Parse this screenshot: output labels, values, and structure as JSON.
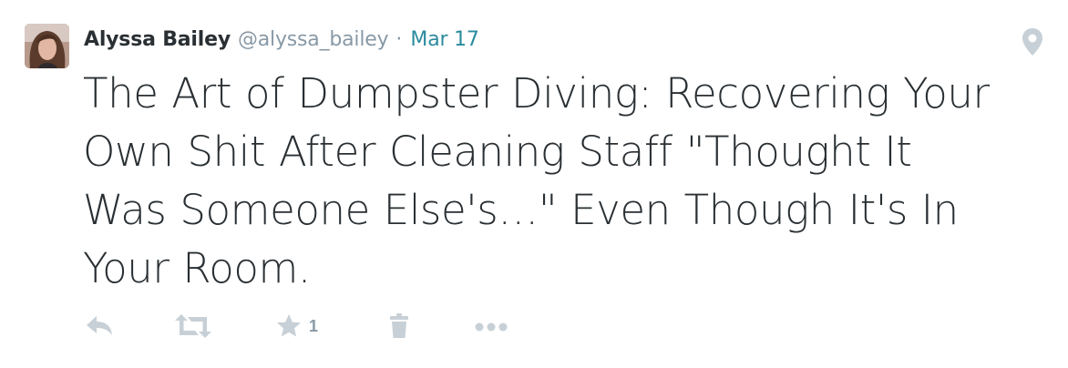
{
  "tweet": {
    "author": {
      "full_name": "Alyssa Bailey",
      "username": "@alyssa_bailey",
      "avatar_icon": "user-avatar-photo"
    },
    "separator": "·",
    "timestamp": "Mar 17",
    "text": "The Art of Dumpster Diving: Recovering Your Own Shit After Cleaning Staff \"Thought It Was Someone Else's…\" Even Though It's In Your Room.",
    "geo_icon": "location-pin-icon",
    "actions": {
      "reply_icon": "reply-icon",
      "retweet_icon": "retweet-icon",
      "favorite_icon": "star-icon",
      "favorite_count": "1",
      "delete_icon": "trash-icon",
      "more_icon": "more-dots-icon"
    },
    "colors": {
      "text": "#292f33",
      "muted": "#8899a6",
      "link": "#2b8a9e",
      "icon": "#c7d0d6"
    }
  }
}
